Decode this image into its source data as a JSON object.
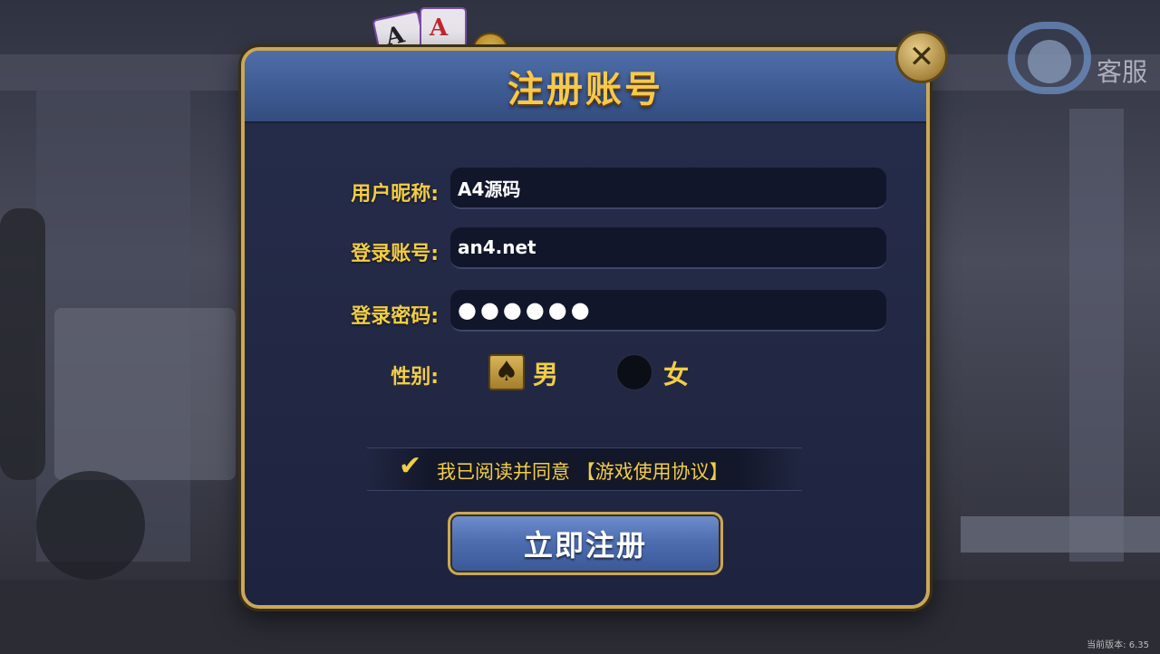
{
  "service": {
    "label": "客服"
  },
  "dialog": {
    "title": "注册账号",
    "close_icon": "close-icon"
  },
  "form": {
    "nickname": {
      "label": "用户昵称:",
      "value": "A4源码"
    },
    "account": {
      "label": "登录账号:",
      "value": "an4.net"
    },
    "password": {
      "label": "登录密码:",
      "value": "●●●●●●"
    },
    "gender": {
      "label": "性别:",
      "options": [
        {
          "label": "男",
          "selected": true,
          "icon": "spade-icon"
        },
        {
          "label": "女",
          "selected": false
        }
      ]
    }
  },
  "agreement": {
    "checked": true,
    "text": "我已阅读并同意",
    "link": "【游戏使用协议】"
  },
  "submit": {
    "label": "立即注册"
  },
  "version": {
    "text": "当前版本: 6.35"
  },
  "colors": {
    "accent_gold": "#f2cd46",
    "header_blue": "#4f6ea8",
    "frame_gold": "#c9a85a"
  }
}
